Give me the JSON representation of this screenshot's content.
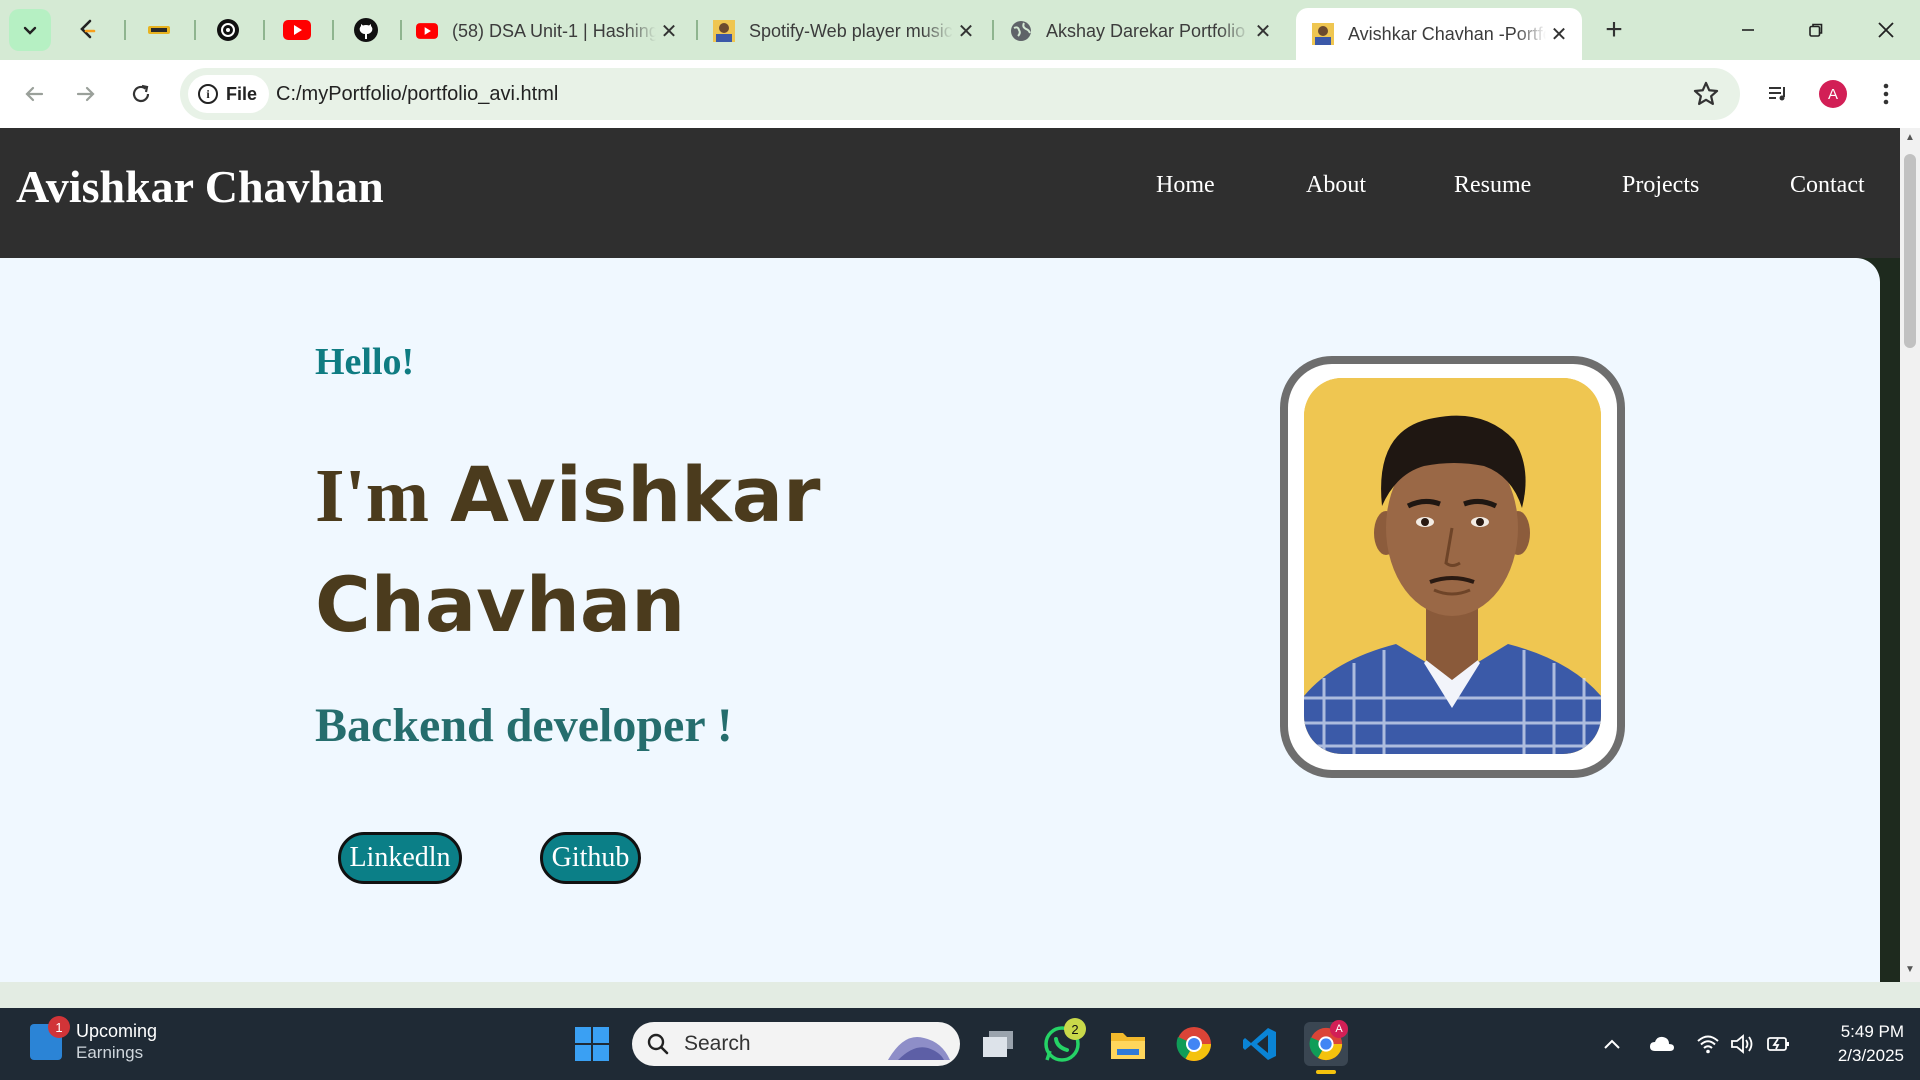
{
  "browser": {
    "tabs": [
      {
        "title": "(58) DSA Unit-1 | Hashing"
      },
      {
        "title": "Spotify-Web player music"
      },
      {
        "title": "Akshay Darekar Portfolio"
      },
      {
        "title": "Avishkar Chavhan -Portfolio"
      }
    ],
    "site_chip": "File",
    "url": "C:/myPortfolio/portfolio_avi.html",
    "profile_initial": "A"
  },
  "page": {
    "brand": "Avishkar Chavhan",
    "nav": [
      "Home",
      "About",
      "Resume",
      "Projects",
      "Contact"
    ],
    "hello": "Hello!",
    "im": "I'm",
    "first_name": "Avishkar",
    "last_name": "Chavhan",
    "role": "Backend developer !",
    "buttons": {
      "linkedin": "Linkedln",
      "github": "Github"
    }
  },
  "taskbar": {
    "widget_title": "Upcoming",
    "widget_sub": "Earnings",
    "widget_badge": "1",
    "search_placeholder": "Search",
    "whatsapp_badge": "2",
    "chrome_badge": "A",
    "time": "5:49 PM",
    "date": "2/3/2025"
  },
  "colors": {
    "header_bg": "#2f2f2f",
    "hero_bg": "#f0f8ff",
    "hello": "#0f7c82",
    "name": "#4b3b1d",
    "role": "#256d6d",
    "button_bg": "#0b7f87",
    "photo_bg": "#efc651"
  }
}
